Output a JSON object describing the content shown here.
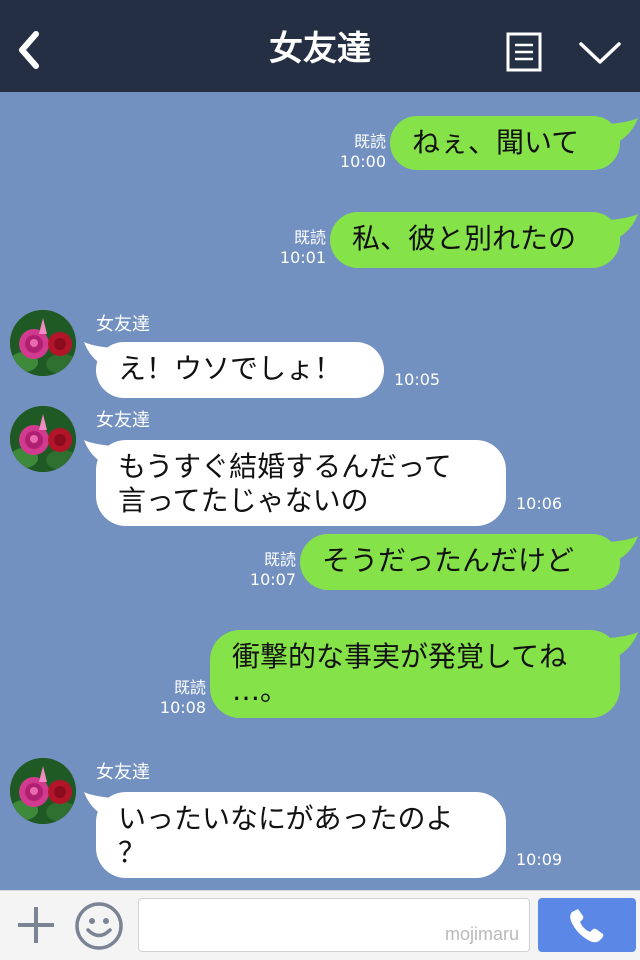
{
  "header": {
    "title": "女友達",
    "back_icon": "chevron-left-icon",
    "notes_icon": "notes-icon",
    "menu_icon": "chevron-down-icon",
    "background": "#252f44"
  },
  "chat": {
    "background": "#7290c0",
    "mine_bubble_color": "#85e249",
    "theirs_bubble_color": "#ffffff",
    "messages": [
      {
        "from": "me",
        "text": "ねぇ、聞いて",
        "read_label": "既読",
        "time": "10:00"
      },
      {
        "from": "me",
        "text": "私、彼と別れたの",
        "read_label": "既読",
        "time": "10:01"
      },
      {
        "from": "friend",
        "sender": "女友達",
        "text": "え！ウソでしょ！",
        "time": "10:05"
      },
      {
        "from": "friend",
        "sender": "女友達",
        "text": "もうすぐ結婚するんだって\n言ってたじゃないの",
        "time": "10:06"
      },
      {
        "from": "me",
        "text": "そうだったんだけど",
        "read_label": "既読",
        "time": "10:07"
      },
      {
        "from": "me",
        "text": "衝撃的な事実が発覚してね\n…。",
        "read_label": "既読",
        "time": "10:08"
      },
      {
        "from": "friend",
        "sender": "女友達",
        "text": "いったいなにがあったのよ\n？",
        "time": "10:09"
      }
    ]
  },
  "input_bar": {
    "plus_icon": "plus-icon",
    "sticker_icon": "smile-icon",
    "watermark": "mojimaru",
    "call_icon": "phone-icon",
    "call_color": "#5b87e6"
  }
}
